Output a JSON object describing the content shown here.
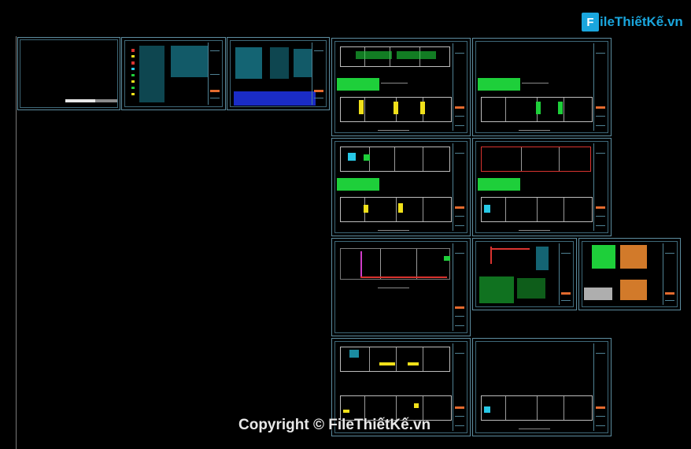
{
  "logo": {
    "mark": "F",
    "text": "ileThiếtKế.vn"
  },
  "watermark": {
    "copyright": "Copyright © FileThiếtKế.vn"
  },
  "colors": {
    "background": "#000000",
    "frame": "#5d8da0",
    "accent_green": "#1ecf3a",
    "accent_yellow": "#f0e01a",
    "accent_cyan": "#27c8e6",
    "accent_orange": "#e36a2e",
    "logo_blue": "#1aa6dd"
  },
  "sheets": [
    {
      "id": "cover",
      "content": "cover-sheet"
    },
    {
      "id": "legend",
      "content": "symbol-legend"
    },
    {
      "id": "details",
      "content": "installation-details"
    },
    {
      "id": "plan-1",
      "content": "floor-plans"
    },
    {
      "id": "plan-2",
      "content": "floor-plans"
    },
    {
      "id": "plan-3",
      "content": "floor-plans"
    },
    {
      "id": "plan-4",
      "content": "floor-plans"
    },
    {
      "id": "plan-5",
      "content": "piping-plan"
    },
    {
      "id": "details-2",
      "content": "riser-details"
    },
    {
      "id": "schedule",
      "content": "panel-schedule"
    },
    {
      "id": "plan-6",
      "content": "floor-plans"
    },
    {
      "id": "plan-7",
      "content": "floor-plans"
    }
  ]
}
